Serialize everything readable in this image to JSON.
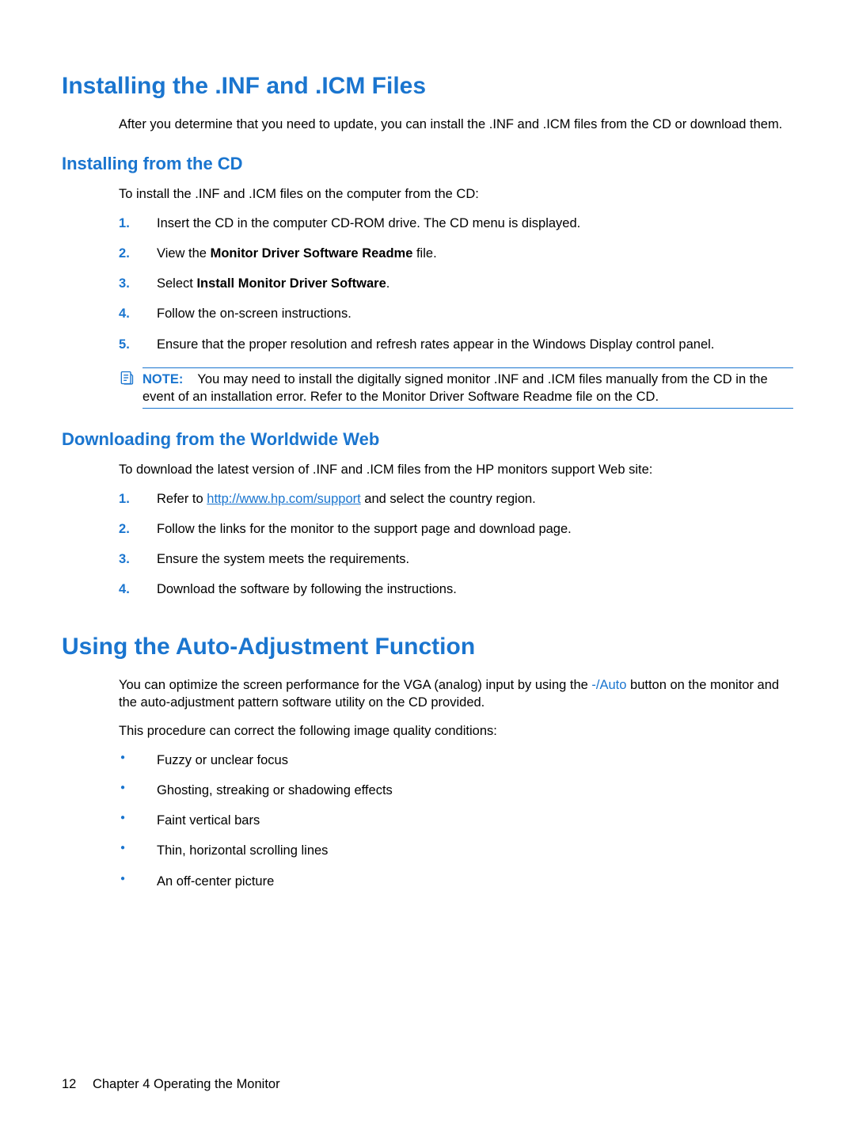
{
  "section1": {
    "heading": "Installing the .INF and .ICM Files",
    "intro": "After you determine that you need to update, you can install the .INF and .ICM files from the CD or download them.",
    "sub1": {
      "heading": "Installing from the CD",
      "intro": "To install the .INF and .ICM files on the computer from the CD:",
      "steps": {
        "s1": "Insert the CD in the computer CD-ROM drive. The CD menu is displayed.",
        "s2_pre": "View the ",
        "s2_bold": "Monitor Driver Software Readme",
        "s2_post": " file.",
        "s3_pre": "Select ",
        "s3_bold": "Install Monitor Driver Software",
        "s3_post": ".",
        "s4": "Follow the on-screen instructions.",
        "s5": "Ensure that the proper resolution and refresh rates appear in the Windows Display control panel."
      },
      "note": {
        "label": "NOTE:",
        "text": "You may need to install the digitally signed monitor .INF and .ICM files manually from the CD in the event of an installation error. Refer to the Monitor Driver Software Readme file on the CD."
      }
    },
    "sub2": {
      "heading": "Downloading from the Worldwide Web",
      "intro": "To download the latest version of .INF and .ICM files from the HP monitors support Web site:",
      "steps": {
        "s1_pre": "Refer to ",
        "s1_link": "http://www.hp.com/support",
        "s1_post": " and select the country region.",
        "s2": "Follow the links for the monitor to the support page and download page.",
        "s3": "Ensure the system meets the requirements.",
        "s4": "Download the software by following the instructions."
      }
    }
  },
  "section2": {
    "heading": "Using the Auto-Adjustment Function",
    "intro_pre": "You can optimize the screen performance for the VGA (analog) input by using the ",
    "intro_accent": "-/Auto",
    "intro_post": " button on the monitor and the auto-adjustment pattern software utility on the CD provided.",
    "para2": "This procedure can correct the following image quality conditions:",
    "bullets": {
      "b1": "Fuzzy or unclear focus",
      "b2": "Ghosting, streaking or shadowing effects",
      "b3": "Faint vertical bars",
      "b4": "Thin, horizontal scrolling lines",
      "b5": "An off-center picture"
    }
  },
  "footer": {
    "pageno": "12",
    "chapter": "Chapter 4   Operating the Monitor"
  }
}
